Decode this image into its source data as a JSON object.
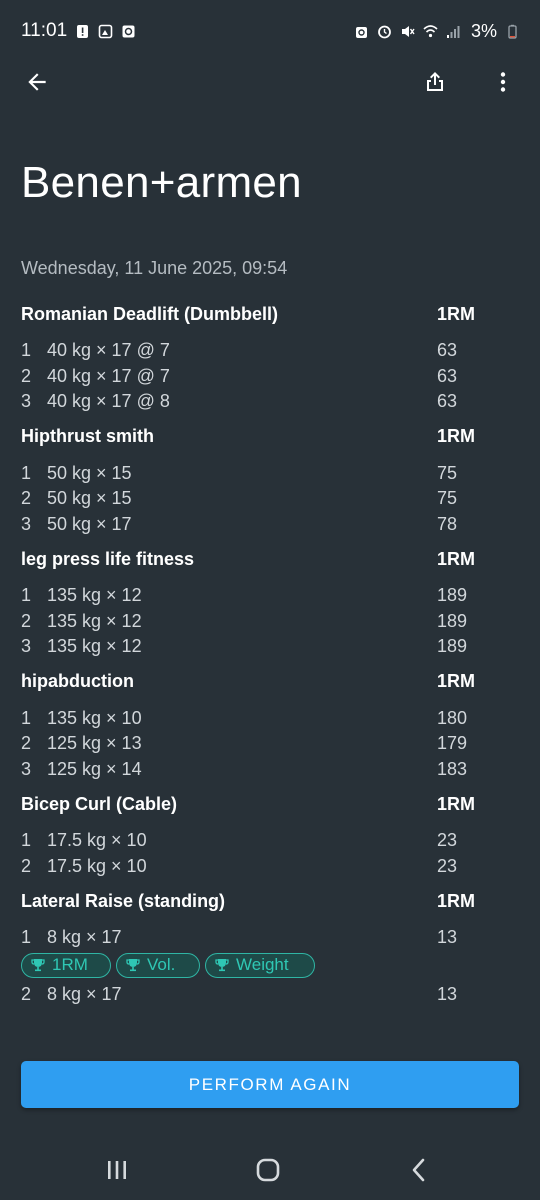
{
  "status_bar": {
    "time": "11:01",
    "battery": "3%",
    "icons_left": [
      "alert-icon",
      "gallery-icon",
      "notification-icon"
    ],
    "icons_right": [
      "alarm-lock-icon",
      "alarm-icon",
      "mute-icon",
      "wifi-icon",
      "signal-icon",
      "battery-icon"
    ]
  },
  "app_bar": {
    "back_icon": "arrow-left-icon",
    "share_icon": "share-icon",
    "more_icon": "more-vert-icon"
  },
  "workout": {
    "title": "Benen+armen",
    "date": "Wednesday, 11 June 2025, 09:54"
  },
  "exercises": [
    {
      "name": "Romanian Deadlift (Dumbbell)",
      "rm_header": "1RM",
      "sets": [
        {
          "num": "1",
          "value": "40 kg × 17 @ 7",
          "rm": "63"
        },
        {
          "num": "2",
          "value": "40 kg × 17 @ 7",
          "rm": "63"
        },
        {
          "num": "3",
          "value": "40 kg × 17 @ 8",
          "rm": "63"
        }
      ]
    },
    {
      "name": "Hipthrust smith",
      "rm_header": "1RM",
      "sets": [
        {
          "num": "1",
          "value": "50 kg × 15",
          "rm": "75"
        },
        {
          "num": "2",
          "value": "50 kg × 15",
          "rm": "75"
        },
        {
          "num": "3",
          "value": "50 kg × 17",
          "rm": "78"
        }
      ]
    },
    {
      "name": "leg press life fitness",
      "rm_header": "1RM",
      "sets": [
        {
          "num": "1",
          "value": "135 kg × 12",
          "rm": "189"
        },
        {
          "num": "2",
          "value": "135 kg × 12",
          "rm": "189"
        },
        {
          "num": "3",
          "value": "135 kg × 12",
          "rm": "189"
        }
      ]
    },
    {
      "name": "hipabduction",
      "rm_header": "1RM",
      "sets": [
        {
          "num": "1",
          "value": "135 kg × 10",
          "rm": "180"
        },
        {
          "num": "2",
          "value": "125 kg × 13",
          "rm": "179"
        },
        {
          "num": "3",
          "value": "125 kg × 14",
          "rm": "183"
        }
      ]
    },
    {
      "name": "Bicep Curl (Cable)",
      "rm_header": "1RM",
      "sets": [
        {
          "num": "1",
          "value": "17.5 kg × 10",
          "rm": "23"
        },
        {
          "num": "2",
          "value": "17.5 kg × 10",
          "rm": "23"
        }
      ]
    },
    {
      "name": "Lateral Raise (standing)",
      "rm_header": "1RM",
      "sets": [
        {
          "num": "1",
          "value": "8 kg × 17",
          "rm": "13"
        },
        {
          "num": "2",
          "value": "8 kg × 17",
          "rm": "13"
        }
      ],
      "records": [
        "1RM",
        "Vol.",
        "Weight"
      ]
    }
  ],
  "perform_again": "PERFORM AGAIN",
  "colors": {
    "background": "#283138",
    "accent": "#2f9ef1",
    "record_badge": "#2fc7b4",
    "secondary_text": "#b5bcc2"
  },
  "nav_bar": {
    "recents_icon": "recents-icon",
    "home_icon": "home-icon",
    "back_icon": "nav-back-icon"
  }
}
